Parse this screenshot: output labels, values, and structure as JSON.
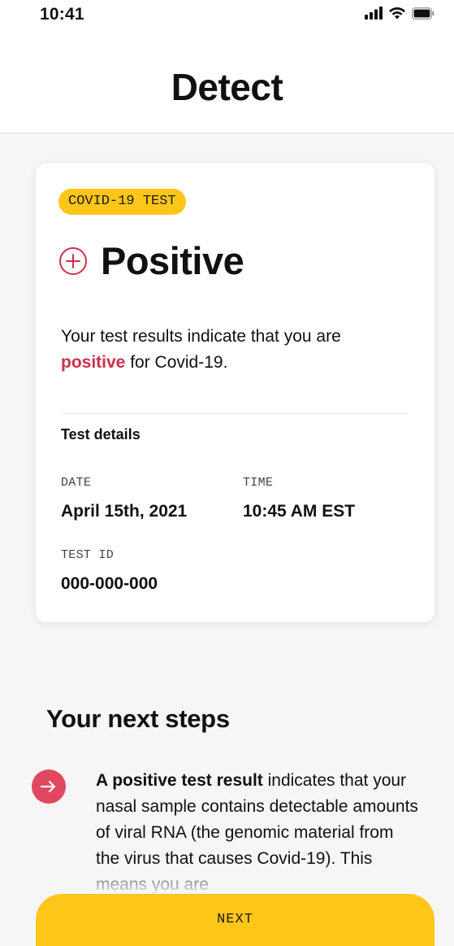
{
  "status_bar": {
    "time": "10:41"
  },
  "header": {
    "title": "Detect"
  },
  "result_card": {
    "badge": "COVID-19 TEST",
    "result_label": "Positive",
    "summary_before": "Your test results indicate that you are ",
    "summary_highlight": "positive",
    "summary_after": " for Covid-19.",
    "details_heading": "Test details",
    "date_label": "DATE",
    "date_value": "April 15th, 2021",
    "time_label": "TIME",
    "time_value": "10:45 AM EST",
    "test_id_label": "TEST ID",
    "test_id_value": "000-000-000"
  },
  "next_steps": {
    "heading": "Your next steps",
    "items": [
      {
        "icon": "arrow-right-icon",
        "bold": "A positive test result",
        "text": " indicates that your nasal sample contains detectable amounts of viral RNA (the genomic material from the virus that causes Covid-19). This means you are"
      }
    ]
  },
  "footer": {
    "next_label": "NEXT"
  },
  "colors": {
    "accent_yellow": "#ffc61a",
    "positive_red": "#cc2f4b",
    "step_icon_red": "#e0485f",
    "background": "#f6f6f6",
    "card": "#ffffff"
  }
}
